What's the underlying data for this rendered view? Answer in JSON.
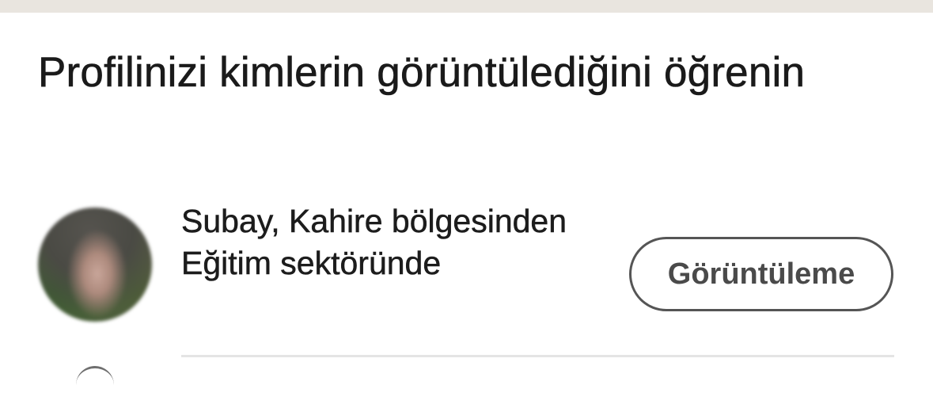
{
  "header": {
    "title": "Profilinizi kimlerin görüntülediğini öğrenin"
  },
  "viewer": {
    "description": "Subay, Kahire bölgesinden Eğitim sektöründe",
    "action_label": "Görüntüleme"
  },
  "colors": {
    "top_strip": "#e9e5df",
    "text": "#1d1d1d",
    "button_border": "#555555",
    "divider": "#e4e4e4"
  }
}
